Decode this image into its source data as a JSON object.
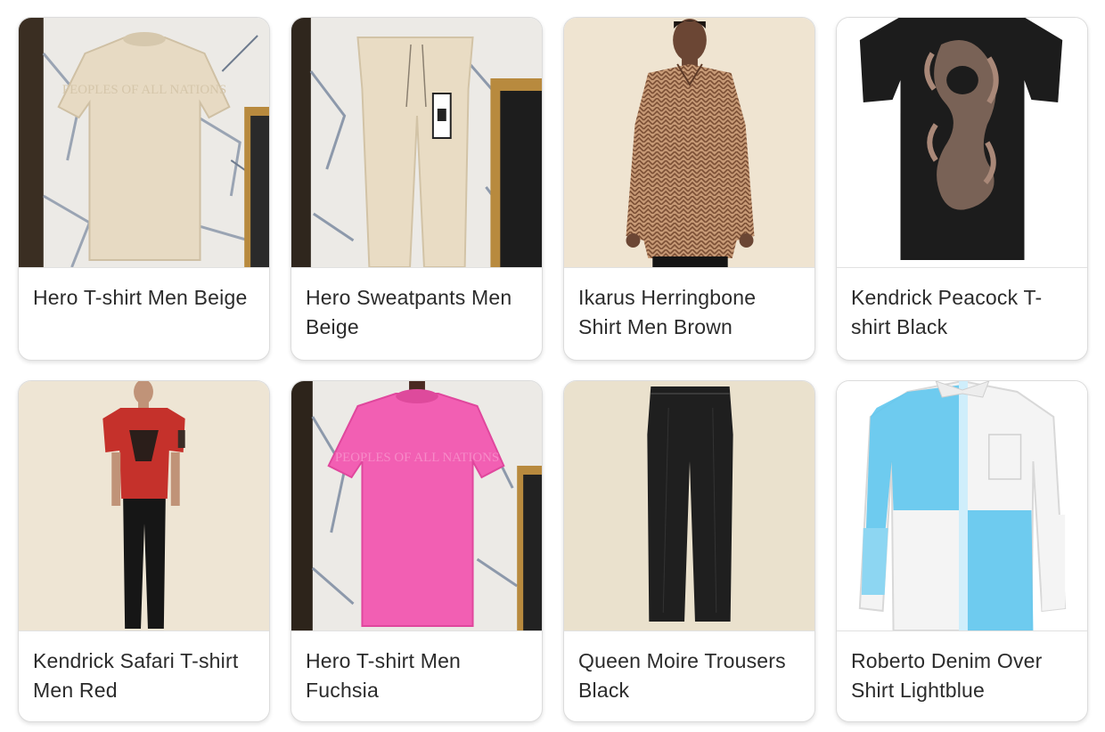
{
  "products": [
    {
      "title": "Hero T-shirt Men Beige",
      "image": "beige-tshirt-on-hanger-marble-backdrop",
      "garment_color": "#e7dac3"
    },
    {
      "title": "Hero Sweatpants Men Beige",
      "image": "beige-sweatpants-on-hanger-marble-backdrop",
      "garment_color": "#e9dcc4"
    },
    {
      "title": "Ikarus Herringbone Shirt Men Brown",
      "image": "model-wearing-brown-herringbone-shirt",
      "garment_color": "#b08262"
    },
    {
      "title": "Kendrick Peacock T-shirt Black",
      "image": "black-tshirt-with-peacock-print",
      "garment_color": "#1c1c1c"
    },
    {
      "title": "Kendrick Safari T-shirt Men Red",
      "image": "model-wearing-red-tshirt-black-trousers",
      "garment_color": "#c5312b"
    },
    {
      "title": "Hero T-shirt Men Fuchsia",
      "image": "fuchsia-tshirt-on-hanger-marble-backdrop",
      "garment_color": "#f25fb3"
    },
    {
      "title": "Queen Moire Trousers Black",
      "image": "black-trousers-flat",
      "garment_color": "#1f1f1f"
    },
    {
      "title": "Roberto Denim Over Shirt Lightblue",
      "image": "white-and-lightblue-colorblock-shirt",
      "garment_color": "#5fc6ee"
    }
  ],
  "print_text": "PEOPLES OF ALL NATIONS"
}
